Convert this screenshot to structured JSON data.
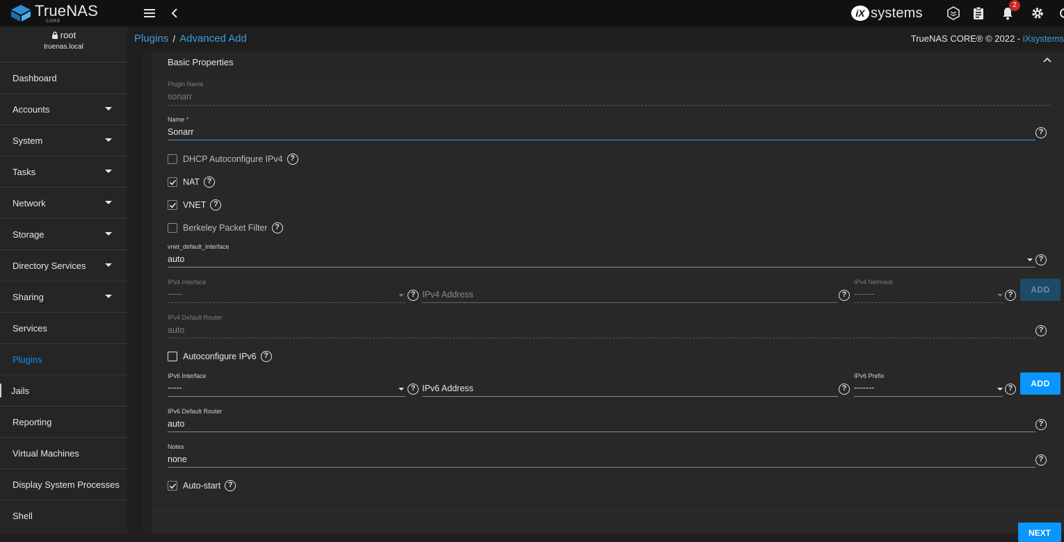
{
  "app": {
    "brand_name": "TrueNAS",
    "brand_sub": "CORE",
    "vendor": "systems",
    "vendor_badge": "iX"
  },
  "topbar": {
    "notification_count": "2"
  },
  "user": {
    "name": "root",
    "host": "truenas.local"
  },
  "sidebar": {
    "items": [
      {
        "label": "Dashboard"
      },
      {
        "label": "Accounts"
      },
      {
        "label": "System"
      },
      {
        "label": "Tasks"
      },
      {
        "label": "Network"
      },
      {
        "label": "Storage"
      },
      {
        "label": "Directory Services"
      },
      {
        "label": "Sharing"
      },
      {
        "label": "Services"
      },
      {
        "label": "Plugins"
      },
      {
        "label": "Jails"
      },
      {
        "label": "Reporting"
      },
      {
        "label": "Virtual Machines"
      },
      {
        "label": "Display System Processes"
      },
      {
        "label": "Shell"
      }
    ]
  },
  "breadcrumb": {
    "first": "Plugins",
    "sep": "/",
    "second": "Advanced Add"
  },
  "copyright": {
    "text": "TrueNAS CORE® © 2022 - ",
    "link": "iXsystems"
  },
  "form": {
    "section_title": "Basic Properties",
    "plugin_name": {
      "label": "Plugin Name",
      "value": "sonarr"
    },
    "name": {
      "label": "Name",
      "required": "*",
      "value": "Sonarr"
    },
    "dhcp": {
      "label": "DHCP Autoconfigure IPv4",
      "checked": false
    },
    "nat": {
      "label": "NAT",
      "checked": true
    },
    "vnet": {
      "label": "VNET",
      "checked": true
    },
    "bpf": {
      "label": "Berkeley Packet Filter",
      "checked": false
    },
    "vnet_default_interface": {
      "label": "vnet_default_interface",
      "value": "auto"
    },
    "ipv4_interface": {
      "label": "IPv4 Interface",
      "value": "-----"
    },
    "ipv4_address": {
      "placeholder": "IPv4 Address"
    },
    "ipv4_netmask": {
      "label": "IPv4 Netmask",
      "value": "-------"
    },
    "ipv4_add": {
      "label": "ADD"
    },
    "ipv4_default_router": {
      "label": "IPv4 Default Router",
      "value": "auto"
    },
    "autoconfig_ipv6": {
      "label": "Autoconfigure IPv6",
      "checked": false
    },
    "ipv6_interface": {
      "label": "IPv6 Interface",
      "value": "-----"
    },
    "ipv6_address": {
      "placeholder": "IPv6 Address"
    },
    "ipv6_prefix": {
      "label": "IPv6 Prefix",
      "value": "-------"
    },
    "ipv6_add": {
      "label": "ADD"
    },
    "ipv6_default_router": {
      "label": "IPv6 Default Router",
      "value": "auto"
    },
    "notes": {
      "label": "Notes",
      "value": "none"
    },
    "autostart": {
      "label": "Auto-start",
      "checked": true
    },
    "next": {
      "label": "NEXT"
    }
  }
}
